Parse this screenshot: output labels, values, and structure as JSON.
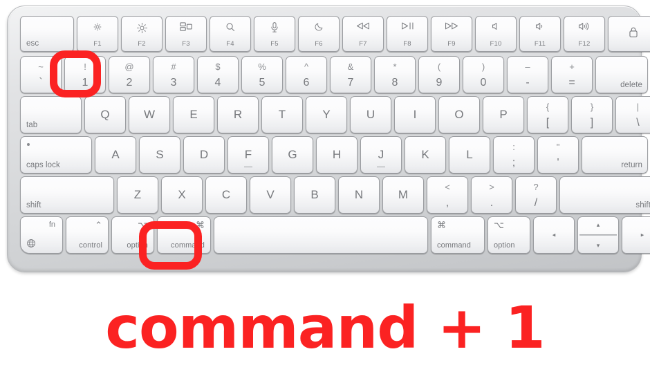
{
  "caption": "command + 1",
  "accent_color": "#fb2222",
  "keyboard": {
    "body_color": "#d8dadc",
    "key_color": "#fafbfc",
    "legend_color": "#76787c",
    "rows": {
      "function_row": [
        {
          "name": "esc",
          "label": "esc"
        },
        {
          "name": "f1",
          "glyph": "brightness-down-icon",
          "fn": "F1"
        },
        {
          "name": "f2",
          "glyph": "brightness-up-icon",
          "fn": "F2"
        },
        {
          "name": "f3",
          "glyph": "mission-control-icon",
          "fn": "F3"
        },
        {
          "name": "f4",
          "glyph": "spotlight-search-icon",
          "fn": "F4"
        },
        {
          "name": "f5",
          "glyph": "dictation-mic-icon",
          "fn": "F5"
        },
        {
          "name": "f6",
          "glyph": "do-not-disturb-icon",
          "fn": "F6"
        },
        {
          "name": "f7",
          "glyph": "rewind-icon",
          "fn": "F7"
        },
        {
          "name": "f8",
          "glyph": "play-pause-icon",
          "fn": "F8"
        },
        {
          "name": "f9",
          "glyph": "fast-forward-icon",
          "fn": "F9"
        },
        {
          "name": "f10",
          "glyph": "mute-icon",
          "fn": "F10"
        },
        {
          "name": "f11",
          "glyph": "volume-down-icon",
          "fn": "F11"
        },
        {
          "name": "f12",
          "glyph": "volume-up-icon",
          "fn": "F12"
        },
        {
          "name": "touch-id",
          "glyph": "lock-touch-id-icon"
        }
      ],
      "number_row": [
        {
          "name": "backtick",
          "top": "~",
          "bottom": "`"
        },
        {
          "name": "one",
          "top": "!",
          "bottom": "1",
          "highlighted": true
        },
        {
          "name": "two",
          "top": "@",
          "bottom": "2"
        },
        {
          "name": "three",
          "top": "#",
          "bottom": "3"
        },
        {
          "name": "four",
          "top": "$",
          "bottom": "4"
        },
        {
          "name": "five",
          "top": "%",
          "bottom": "5"
        },
        {
          "name": "six",
          "top": "^",
          "bottom": "6"
        },
        {
          "name": "seven",
          "top": "&",
          "bottom": "7"
        },
        {
          "name": "eight",
          "top": "*",
          "bottom": "8"
        },
        {
          "name": "nine",
          "top": "(",
          "bottom": "9"
        },
        {
          "name": "zero",
          "top": ")",
          "bottom": "0"
        },
        {
          "name": "minus",
          "top": "–",
          "bottom": "-"
        },
        {
          "name": "equals",
          "top": "+",
          "bottom": "="
        },
        {
          "name": "delete",
          "label": "delete"
        }
      ],
      "qwerty_row": [
        {
          "name": "tab",
          "label": "tab"
        },
        {
          "name": "q",
          "label": "Q"
        },
        {
          "name": "w",
          "label": "W"
        },
        {
          "name": "e",
          "label": "E"
        },
        {
          "name": "r",
          "label": "R"
        },
        {
          "name": "t",
          "label": "T"
        },
        {
          "name": "y",
          "label": "Y"
        },
        {
          "name": "u",
          "label": "U"
        },
        {
          "name": "i",
          "label": "I"
        },
        {
          "name": "o",
          "label": "O"
        },
        {
          "name": "p",
          "label": "P"
        },
        {
          "name": "left-bracket",
          "top": "{",
          "bottom": "["
        },
        {
          "name": "right-bracket",
          "top": "}",
          "bottom": "]"
        },
        {
          "name": "backslash",
          "top": "|",
          "bottom": "\\"
        }
      ],
      "home_row": [
        {
          "name": "caps-lock",
          "label": "caps lock"
        },
        {
          "name": "a",
          "label": "A"
        },
        {
          "name": "s",
          "label": "S"
        },
        {
          "name": "d",
          "label": "D"
        },
        {
          "name": "f",
          "label": "F",
          "home_indicator": true
        },
        {
          "name": "g",
          "label": "G"
        },
        {
          "name": "h",
          "label": "H"
        },
        {
          "name": "j",
          "label": "J",
          "home_indicator": true
        },
        {
          "name": "k",
          "label": "K"
        },
        {
          "name": "l",
          "label": "L"
        },
        {
          "name": "semicolon",
          "top": ":",
          "bottom": ";"
        },
        {
          "name": "quote",
          "top": "\"",
          "bottom": "'"
        },
        {
          "name": "return",
          "label": "return"
        }
      ],
      "shift_row": [
        {
          "name": "left-shift",
          "label": "shift"
        },
        {
          "name": "z",
          "label": "Z"
        },
        {
          "name": "x",
          "label": "X"
        },
        {
          "name": "c",
          "label": "C"
        },
        {
          "name": "v",
          "label": "V"
        },
        {
          "name": "b",
          "label": "B"
        },
        {
          "name": "n",
          "label": "N"
        },
        {
          "name": "m",
          "label": "M"
        },
        {
          "name": "comma",
          "top": "<",
          "bottom": ","
        },
        {
          "name": "period",
          "top": ">",
          "bottom": "."
        },
        {
          "name": "slash",
          "top": "?",
          "bottom": "/"
        },
        {
          "name": "right-shift",
          "label": "shift"
        }
      ],
      "bottom_row": [
        {
          "name": "fn",
          "symbol": "fn",
          "word": "",
          "glyph": "globe-icon"
        },
        {
          "name": "left-control",
          "symbol": "⌃",
          "word": "control"
        },
        {
          "name": "left-option",
          "symbol": "⌥",
          "word": "option"
        },
        {
          "name": "left-command",
          "symbol": "⌘",
          "word": "command",
          "highlighted": true
        },
        {
          "name": "space",
          "label": ""
        },
        {
          "name": "right-command",
          "symbol": "⌘",
          "word": "command"
        },
        {
          "name": "right-option",
          "symbol": "⌥",
          "word": "option"
        },
        {
          "name": "arrow-left",
          "glyph": "◂"
        },
        {
          "name": "arrow-up-down",
          "up": "▴",
          "down": "▾"
        },
        {
          "name": "arrow-right",
          "glyph": "▸"
        }
      ]
    }
  }
}
